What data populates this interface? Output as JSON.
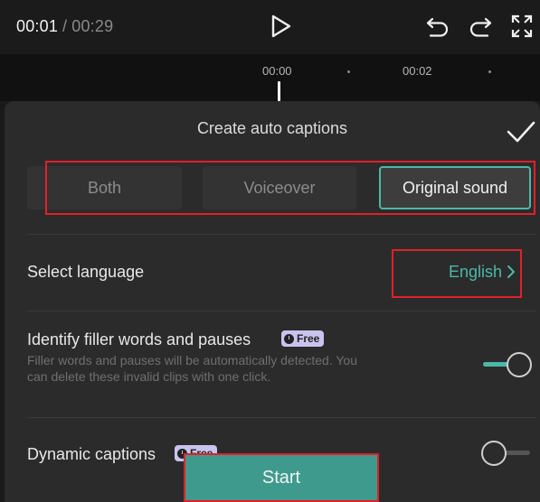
{
  "player": {
    "current_time": "00:01",
    "separator": "/",
    "duration": "00:29",
    "icons": [
      "play-icon",
      "undo-icon",
      "redo-icon",
      "fullscreen-icon"
    ]
  },
  "timeline": {
    "ticks": [
      "00:00",
      "00:02"
    ]
  },
  "sheet": {
    "title": "Create auto captions",
    "confirm_icon": "checkmark-icon",
    "source_options": [
      "Both",
      "Voiceover",
      "Original sound"
    ],
    "selected_source": "Original sound",
    "language": {
      "label": "Select language",
      "value": "English",
      "icon": "chevron-right-icon"
    },
    "filler": {
      "label": "Identify filler words and pauses",
      "badge": "Free",
      "description": "Filler words and pauses will be automatically detected. You can delete these invalid clips with one click.",
      "enabled": true
    },
    "dynamic": {
      "label": "Dynamic captions",
      "badge": "Free",
      "enabled": false
    },
    "start_label": "Start"
  },
  "colors": {
    "accent": "#4cb8a8",
    "highlight": "#e0202a",
    "sheet_bg": "#2b2b2b",
    "start_bg": "#3f9a8e"
  }
}
